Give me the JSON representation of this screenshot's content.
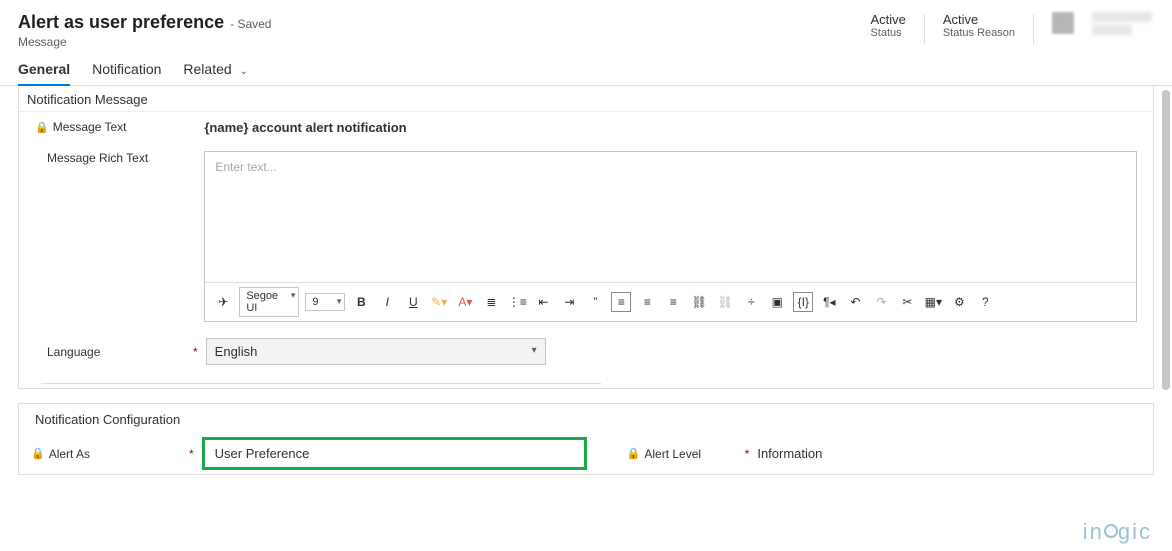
{
  "header": {
    "title": "Alert as user preference",
    "saved": "- Saved",
    "subtitle": "Message",
    "status_value": "Active",
    "status_label": "Status",
    "reason_value": "Active",
    "reason_label": "Status Reason"
  },
  "tabs": {
    "general": "General",
    "notification": "Notification",
    "related": "Related"
  },
  "section1": {
    "title": "Notification Message",
    "message_text_label": "Message Text",
    "message_text_value": "{name} account alert notification",
    "rich_text_label": "Message Rich Text",
    "rich_text_placeholder": "Enter text...",
    "language_label": "Language",
    "language_value": "English"
  },
  "toolbar": {
    "font": "Segoe UI",
    "size": "9"
  },
  "section2": {
    "title": "Notification Configuration",
    "alert_as_label": "Alert As",
    "alert_as_value": "User Preference",
    "alert_level_label": "Alert Level",
    "alert_level_value": "Information"
  },
  "watermark": "inogic"
}
